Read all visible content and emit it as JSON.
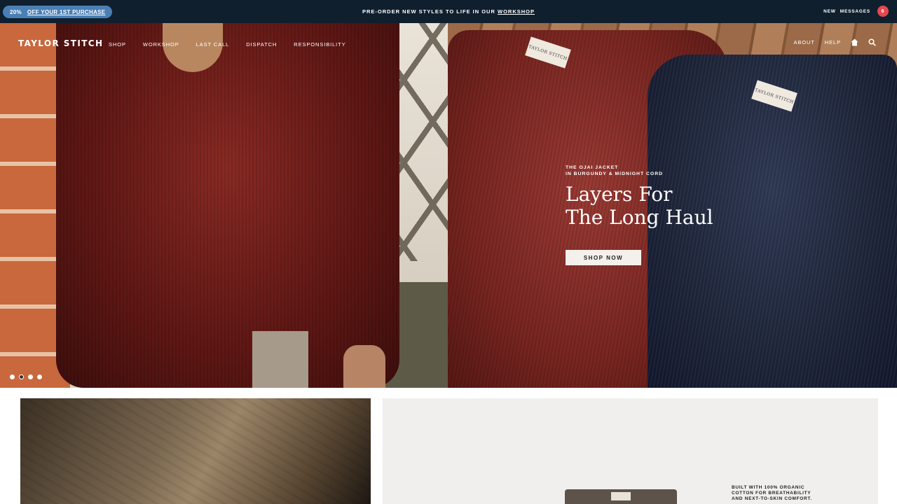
{
  "announcement": {
    "promo_percent": "20%",
    "promo_link": "OFF YOUR 1ST PURCHASE",
    "message_prefix": "PRE-ORDER NEW STYLES TO LIFE IN OUR",
    "message_link": "WORKSHOP",
    "new_label": "NEW",
    "messages_label": "MESSAGES",
    "messages_count": "6",
    "colors": {
      "bar": "#0f1f2e",
      "pill": "#4a7fb5",
      "badge": "#e5484d"
    }
  },
  "nav": {
    "logo": "TAYLOR STITCH",
    "items": [
      "SHOP",
      "WORKSHOP",
      "LAST CALL",
      "DISPATCH",
      "RESPONSIBILITY"
    ],
    "right_items": [
      "ABOUT",
      "HELP"
    ],
    "icons": [
      "home-icon",
      "search-icon"
    ]
  },
  "hero": {
    "eyebrow_line1": "THE OJAI JACKET",
    "eyebrow_line2": "IN BURGUNDY & MIDNIGHT CORD",
    "headline_line1": "Layers For",
    "headline_line2": "The Long Haul",
    "cta": "SHOP NOW",
    "tag_text": "TAYLOR STITCH",
    "carousel_dots": 4,
    "active_dot": 2
  },
  "feature": {
    "copy_line1": "BUILT WITH 100% ORGANIC",
    "copy_line2": "COTTON FOR BREATHABILITY",
    "copy_line3": "AND NEXT-TO-SKIN COMFORT."
  }
}
